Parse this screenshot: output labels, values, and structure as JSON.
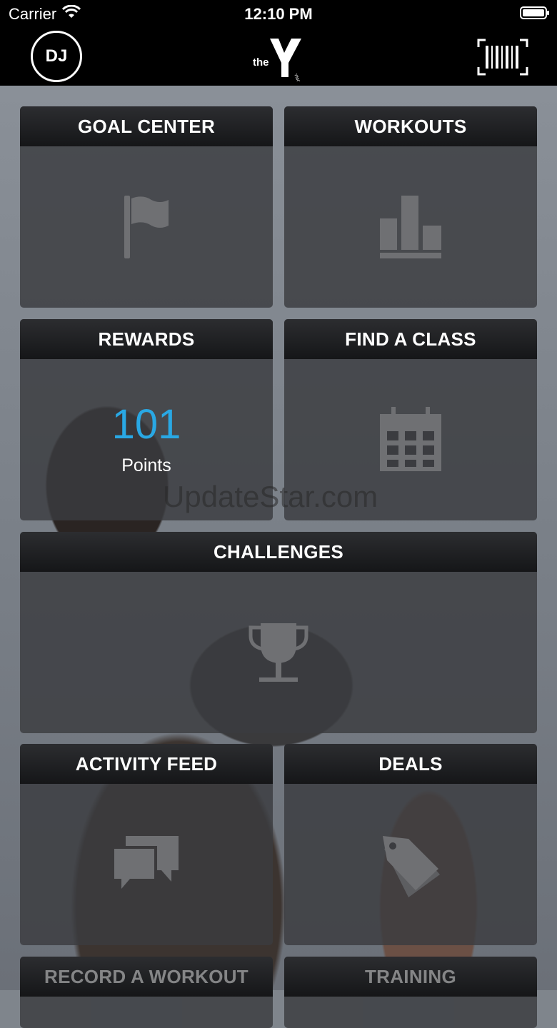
{
  "status_bar": {
    "carrier": "Carrier",
    "time": "12:10 PM"
  },
  "nav": {
    "avatar_initials": "DJ",
    "logo_text": "the",
    "logo_small": "YMCA"
  },
  "tiles": {
    "goal_center": {
      "label": "GOAL CENTER",
      "icon": "flag-icon"
    },
    "workouts": {
      "label": "WORKOUTS",
      "icon": "bar-chart-icon"
    },
    "rewards": {
      "label": "REWARDS",
      "points_value": "101",
      "points_label": "Points"
    },
    "find_a_class": {
      "label": "FIND A CLASS",
      "icon": "calendar-icon"
    },
    "challenges": {
      "label": "CHALLENGES",
      "icon": "trophy-icon"
    },
    "activity_feed": {
      "label": "ACTIVITY FEED",
      "icon": "chat-bubbles-icon"
    },
    "deals": {
      "label": "DEALS",
      "icon": "tag-icon"
    },
    "record_workout": {
      "label": "RECORD A WORKOUT"
    },
    "training": {
      "label": "TRAINING"
    }
  },
  "watermark": "UpdateStar.com",
  "colors": {
    "accent": "#29a8e4",
    "bar": "#000000"
  }
}
